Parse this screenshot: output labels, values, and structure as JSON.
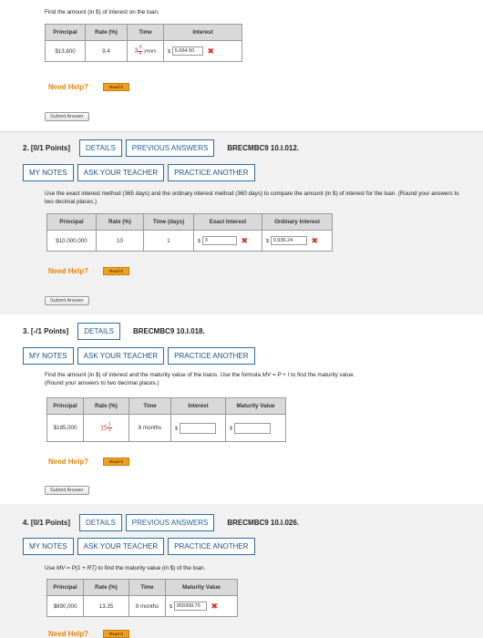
{
  "q1": {
    "prompt": "Find the amount (in $) of interest on the loan.",
    "headers": [
      "Principal",
      "Rate (%)",
      "Time",
      "Interest"
    ],
    "principal": "$13,800",
    "rate": "9.4",
    "time_whole": "3",
    "time_num": "3",
    "time_den": "4",
    "time_unit": "years",
    "dollar": "$",
    "interest_value": "5,664.50",
    "need_help": "Need Help?",
    "read_it": "Read It",
    "submit": "Submit Answer"
  },
  "q2": {
    "number": "2.",
    "points": "[0/1 Points]",
    "details": "DETAILS",
    "previous_answers": "PREVIOUS ANSWERS",
    "code": "BRECMBC9 10.I.012.",
    "my_notes": "MY NOTES",
    "ask_teacher": "ASK YOUR TEACHER",
    "practice_another": "PRACTICE ANOTHER",
    "prompt": "Use the exact interest method (365 days) and the ordinary interest method (360 days) to compare the amount (in $) of interest for the loan. (Round your answers to two decimal places.)",
    "headers": [
      "Principal",
      "Rate (%)",
      "Time (days)",
      "Exact Interest",
      "Ordinary Interest"
    ],
    "principal": "$10,000,000",
    "rate": "10",
    "time": "1",
    "dollar": "$",
    "exact_value": "3",
    "ordinary_value": "9,936.24",
    "need_help": "Need Help?",
    "read_it": "Read It",
    "submit": "Submit Answer"
  },
  "q3": {
    "number": "3.",
    "points": "[-/1 Points]",
    "details": "DETAILS",
    "code": "BRECMBC9 10.I.018.",
    "my_notes": "MY NOTES",
    "ask_teacher": "ASK YOUR TEACHER",
    "practice_another": "PRACTICE ANOTHER",
    "prompt_a": "Find the amount (in $) of interest and the maturity value of the loans. Use the formula ",
    "prompt_formula": "MV = P + I",
    "prompt_b": " to find the maturity value.",
    "prompt_c": "(Round your answers to two decimal places.)",
    "headers": [
      "Principal",
      "Rate (%)",
      "Time",
      "Interest",
      "Maturity Value"
    ],
    "principal": "$185,000",
    "rate_whole": "15",
    "rate_num": "1",
    "rate_den": "2",
    "time": "8 months",
    "dollar": "$",
    "interest_value": "",
    "maturity_value": "",
    "need_help": "Need Help?",
    "read_it": "Read It",
    "submit": "Submit Answer"
  },
  "q4": {
    "number": "4.",
    "points": "[0/1 Points]",
    "details": "DETAILS",
    "previous_answers": "PREVIOUS ANSWERS",
    "code": "BRECMBC9 10.I.026.",
    "my_notes": "MY NOTES",
    "ask_teacher": "ASK YOUR TEACHER",
    "practice_another": "PRACTICE ANOTHER",
    "prompt_a": "Use ",
    "prompt_formula": "MV = P(1 + RT)",
    "prompt_b": " to find the maturity value (in $) of the loan.",
    "headers": [
      "Principal",
      "Rate (%)",
      "Time",
      "Maturity Value"
    ],
    "principal": "$890,000",
    "rate": "13.35",
    "time": "9 months",
    "dollar": "$",
    "maturity_value": "959308.75",
    "need_help": "Need Help?",
    "read_it": "Read It"
  }
}
